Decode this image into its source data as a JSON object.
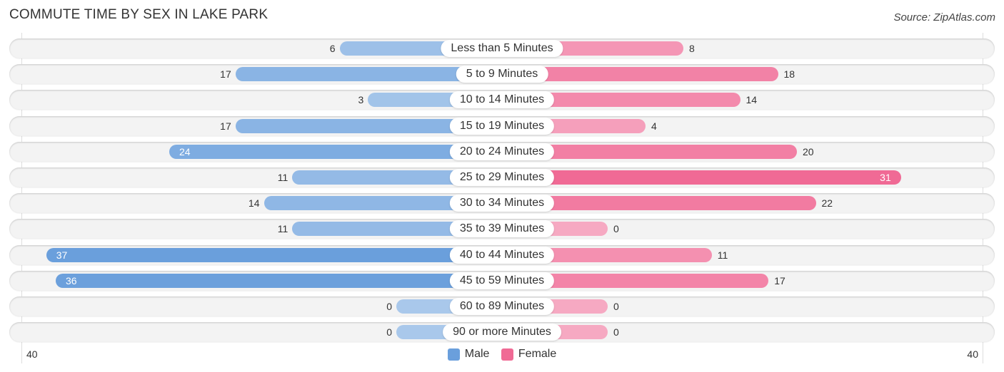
{
  "title": "COMMUTE TIME BY SEX IN LAKE PARK",
  "source": "Source: ZipAtlas.com",
  "colors": {
    "male": "#6a9fdc",
    "female": "#f06a95",
    "male_light": "#a9c8eb",
    "female_light": "#f6a9c2"
  },
  "chart_data": {
    "type": "bar",
    "orientation": "diverging-horizontal",
    "title": "COMMUTE TIME BY SEX IN LAKE PARK",
    "categories": [
      "Less than 5 Minutes",
      "5 to 9 Minutes",
      "10 to 14 Minutes",
      "15 to 19 Minutes",
      "20 to 24 Minutes",
      "25 to 29 Minutes",
      "30 to 34 Minutes",
      "35 to 39 Minutes",
      "40 to 44 Minutes",
      "45 to 59 Minutes",
      "60 to 89 Minutes",
      "90 or more Minutes"
    ],
    "series": [
      {
        "name": "Male",
        "values": [
          6,
          17,
          3,
          17,
          24,
          11,
          14,
          11,
          37,
          36,
          0,
          0
        ]
      },
      {
        "name": "Female",
        "values": [
          8,
          18,
          14,
          4,
          20,
          31,
          22,
          0,
          11,
          17,
          0,
          0
        ]
      }
    ],
    "xlim": [
      -40,
      40
    ],
    "axis_labels": {
      "left": "40",
      "right": "40"
    },
    "legend": {
      "position": "bottom-center",
      "entries": [
        "Male",
        "Female"
      ]
    },
    "grid": false
  }
}
